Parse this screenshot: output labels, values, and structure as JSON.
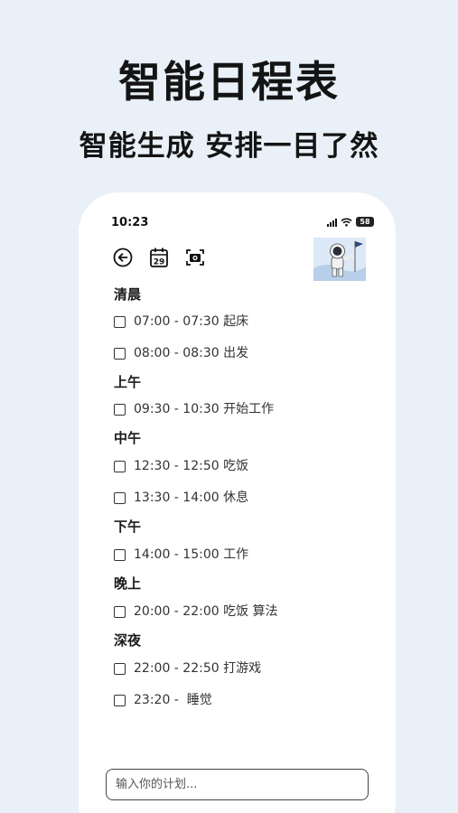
{
  "promo": {
    "title": "智能日程表",
    "subtitle": "智能生成 安排一目了然"
  },
  "status_bar": {
    "time": "10:23",
    "battery": "58"
  },
  "toolbar": {
    "icons": [
      "back-arrow-icon",
      "calendar-icon",
      "camera-icon"
    ],
    "calendar_day": "29"
  },
  "schedule": [
    {
      "period": "清晨",
      "tasks": [
        {
          "time": "07:00 -  07:30",
          "title": "起床"
        },
        {
          "time": "08:00 -  08:30",
          "title": "出发"
        }
      ]
    },
    {
      "period": "上午",
      "tasks": [
        {
          "time": "09:30 -  10:30",
          "title": "开始工作"
        }
      ]
    },
    {
      "period": "中午",
      "tasks": [
        {
          "time": "12:30 -  12:50",
          "title": "吃饭"
        },
        {
          "time": "13:30 -  14:00",
          "title": "休息"
        }
      ]
    },
    {
      "period": "下午",
      "tasks": [
        {
          "time": "14:00 -  15:00",
          "title": "工作"
        }
      ]
    },
    {
      "period": "晚上",
      "tasks": [
        {
          "time": "20:00 -  22:00",
          "title": "吃饭 算法"
        }
      ]
    },
    {
      "period": "深夜",
      "tasks": [
        {
          "time": "22:00 -  22:50",
          "title": "打游戏"
        },
        {
          "time": "23:20 -",
          "title": "睡觉"
        }
      ]
    }
  ],
  "input": {
    "placeholder": "输入你的计划..."
  },
  "colors": {
    "background": "#e9f0f7",
    "card": "#ffffff",
    "text": "#111111"
  }
}
